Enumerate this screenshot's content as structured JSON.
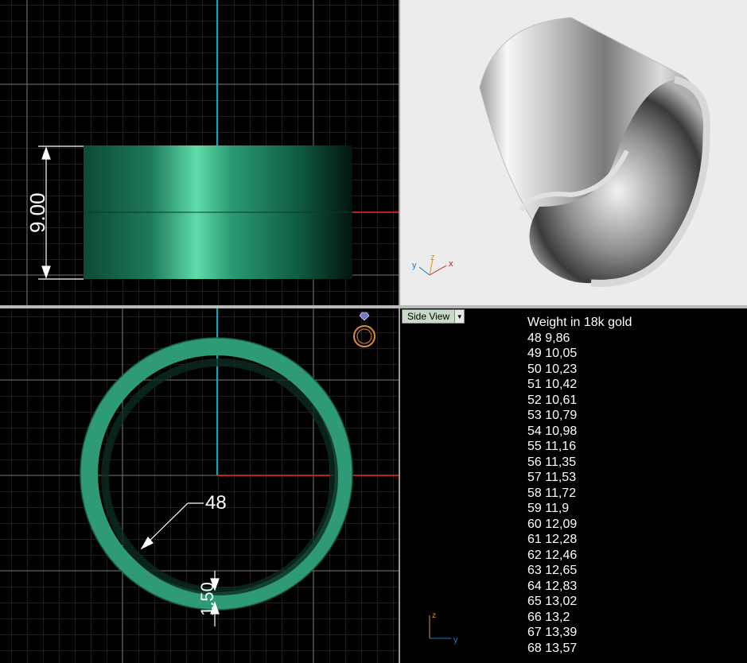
{
  "viewports": {
    "front": {
      "dimension_label": "9.00"
    },
    "top": {
      "diameter_label": "48",
      "thickness_label": "1.50"
    },
    "perspective": {
      "axis_labels": {
        "x": "x",
        "y": "y",
        "z": "z"
      }
    },
    "side": {
      "view_label": "Side View",
      "dropdown_icon": "chevron-down-icon",
      "axis_labels": {
        "y": "y",
        "z": "z"
      }
    }
  },
  "weights_table": {
    "title": "Weight in 18k gold",
    "rows": [
      "48 9,86",
      "49 10,05",
      "50 10,23",
      "51 10,42",
      "52 10,61",
      "53 10,79",
      "54 10,98",
      "55 11,16",
      "56 11,35",
      "57 11,53",
      "58 11,72",
      "59 11,9",
      "60 12,09",
      "61 12,28",
      "62 12,46",
      "63 12,65",
      "64 12,83",
      "65 13,02",
      "66 13,2",
      "67 13,39",
      "68 13,57"
    ]
  },
  "colors": {
    "grid_minor": "#3c3c3c",
    "grid_major": "#7a7a7a",
    "model_green": "#2f9a78",
    "axis_red": "#c0201a",
    "axis_cyan": "#1aa0b8"
  }
}
